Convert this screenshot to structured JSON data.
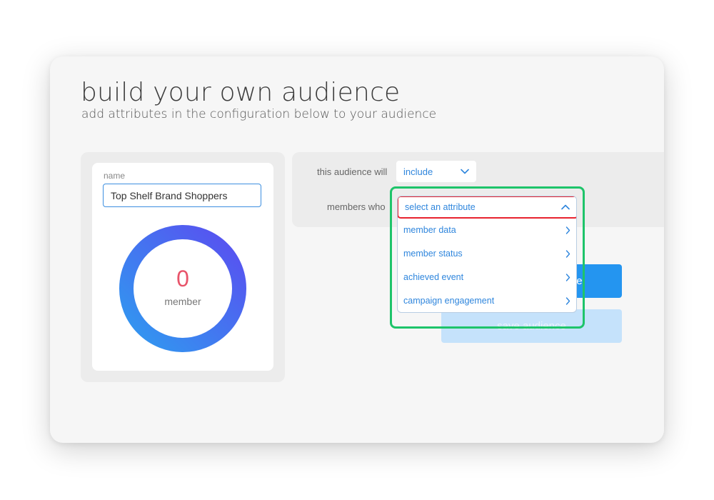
{
  "page": {
    "title": "build your own audience",
    "subtitle": "add attributes in the configuration below to your audience"
  },
  "audience": {
    "name_label": "name",
    "name_value": "Top Shelf Brand Shoppers",
    "member_count": "0",
    "member_label": "member",
    "member_fraction": 1
  },
  "config": {
    "will_label": "this audience will",
    "include_value": "include",
    "members_who_label": "members who"
  },
  "attribute_dropdown": {
    "placeholder": "select an attribute",
    "items": [
      {
        "label": "member data"
      },
      {
        "label": "member status"
      },
      {
        "label": "achieved event"
      },
      {
        "label": "campaign engagement"
      }
    ]
  },
  "buttons": {
    "primary_visible_text": "nce",
    "secondary_visible_text": "save audience"
  },
  "icons": {
    "chevron_down": "chevron-down-icon",
    "chevron_up": "chevron-up-icon",
    "chevron_right": "chevron-right-icon"
  },
  "colors": {
    "accent": "#2f86dd",
    "primary_button": "#2495f0",
    "secondary_button": "#c5e2fb",
    "count": "#e8546a",
    "donut_start": "#2f9bf0",
    "donut_end": "#5a4df0",
    "annotation_green": "#1ec46a",
    "annotation_red": "#e8232f"
  }
}
